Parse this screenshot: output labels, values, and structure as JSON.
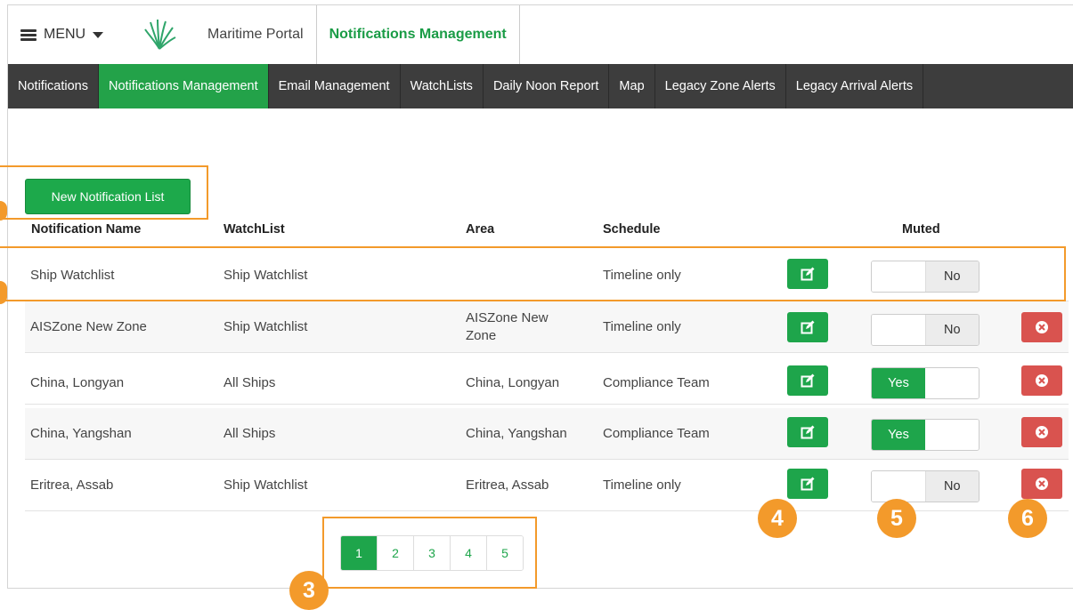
{
  "header": {
    "menu_label": "MENU",
    "portal_name": "Maritime Portal",
    "current_page": "Notifications Management"
  },
  "nav": {
    "items": [
      {
        "label": "Notifications",
        "active": false
      },
      {
        "label": "Notifications Management",
        "active": true
      },
      {
        "label": "Email Management",
        "active": false
      },
      {
        "label": "WatchLists",
        "active": false
      },
      {
        "label": "Daily Noon Report",
        "active": false
      },
      {
        "label": "Map",
        "active": false
      },
      {
        "label": "Legacy Zone Alerts",
        "active": false
      },
      {
        "label": "Legacy Arrival Alerts",
        "active": false
      }
    ]
  },
  "new_list_button": "New Notification List",
  "table": {
    "columns": [
      "Notification Name",
      "WatchList",
      "Area",
      "Schedule",
      "Muted"
    ],
    "rows": [
      {
        "name": "Ship Watchlist",
        "watchlist": "Ship Watchlist",
        "area": "",
        "schedule": "Timeline only",
        "muted": "No",
        "deletable": false
      },
      {
        "name": "AISZone New Zone",
        "watchlist": "Ship Watchlist",
        "area": "AISZone New Zone",
        "schedule": "Timeline only",
        "muted": "No",
        "deletable": true
      },
      {
        "name": "China, Longyan",
        "watchlist": "All Ships",
        "area": "China, Longyan",
        "schedule": "Compliance Team",
        "muted": "Yes",
        "deletable": true
      },
      {
        "name": "China, Yangshan",
        "watchlist": "All Ships",
        "area": "China, Yangshan",
        "schedule": "Compliance Team",
        "muted": "Yes",
        "deletable": true
      },
      {
        "name": "Eritrea, Assab",
        "watchlist": "Ship Watchlist",
        "area": "Eritrea, Assab",
        "schedule": "Timeline only",
        "muted": "No",
        "deletable": true
      }
    ]
  },
  "pagination": {
    "pages": [
      "1",
      "2",
      "3",
      "4",
      "5"
    ],
    "current": "1"
  },
  "callouts": [
    "3",
    "4",
    "5",
    "6"
  ],
  "colors": {
    "accent_green": "#1ea54b",
    "nav_dark": "#3d3d3d",
    "delete_red": "#d9534f",
    "callout_orange": "#f39a2b"
  }
}
